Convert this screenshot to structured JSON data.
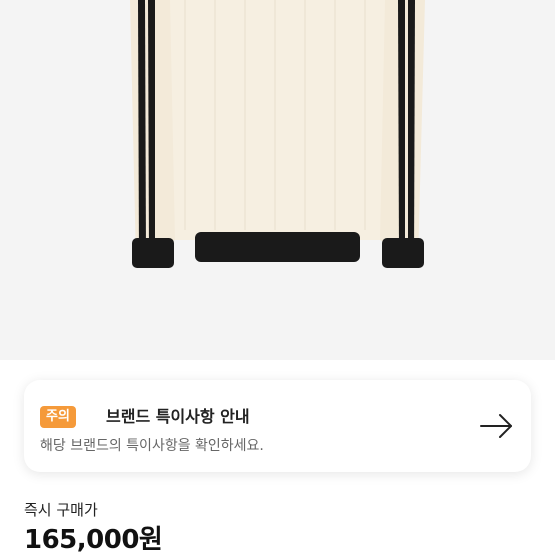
{
  "notice": {
    "badge": "주의",
    "title": "브랜드 특이사항 안내",
    "subtitle": "해당 브랜드의 특이사항을 확인하세요.",
    "arrow_icon": "arrow-right-icon"
  },
  "purchase": {
    "label": "즉시 구매가",
    "price": "165,000원"
  },
  "colors": {
    "badge": "#f59a3a",
    "sweater": "#f6efe1",
    "stripe": "#1a1a1a",
    "hero_bg": "#f4f4f4"
  }
}
